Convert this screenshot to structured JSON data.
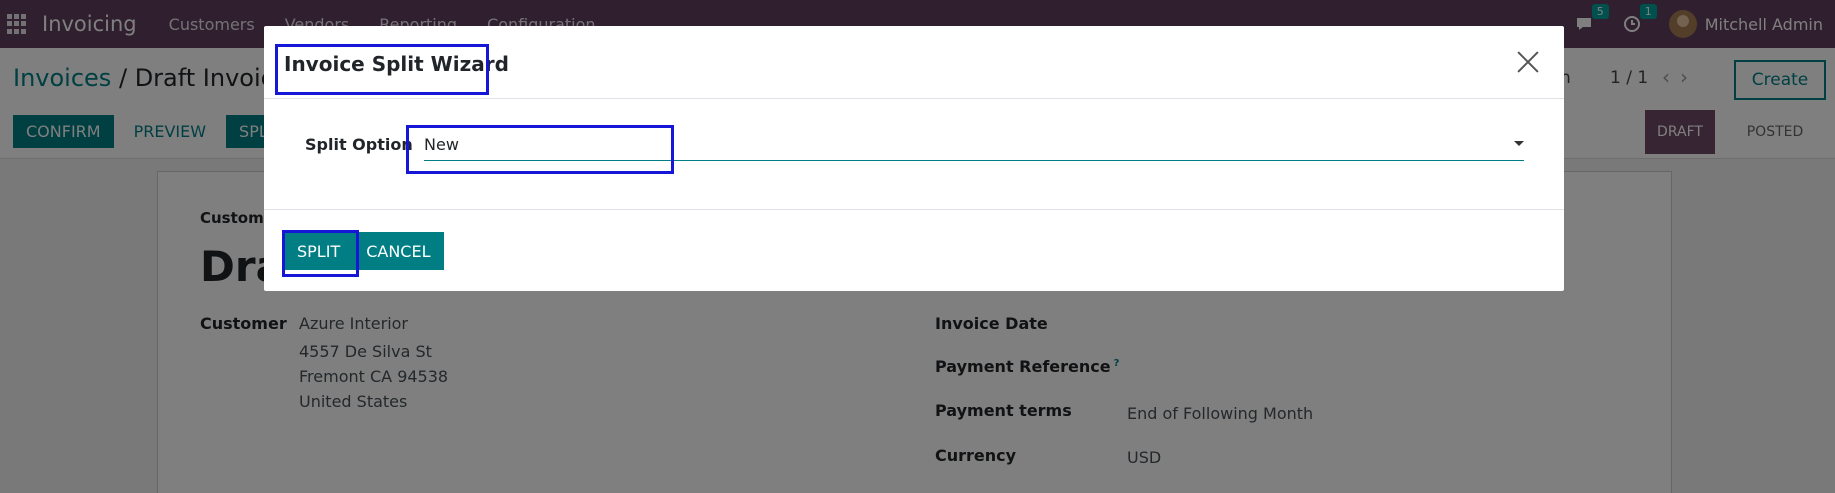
{
  "topnav": {
    "app_title": "Invoicing",
    "menu": [
      "Customers",
      "Vendors",
      "Reporting",
      "Configuration"
    ],
    "messages_badge": "5",
    "activities_badge": "1",
    "user": "Mitchell Admin"
  },
  "control": {
    "breadcrumb_root": "Invoices",
    "breadcrumb_sep": "/",
    "breadcrumb_current": "Draft Invoice",
    "pager": "1 / 1",
    "pager_partial": "n",
    "create": "Create",
    "buttons": [
      "CONFIRM",
      "PREVIEW",
      "SPLIT"
    ],
    "status": [
      "DRAFT",
      "POSTED"
    ]
  },
  "sheet": {
    "customer_top_label": "Customer",
    "title": "Draft",
    "customer_label": "Customer",
    "customer_name": "Azure Interior",
    "address1": "4557 De Silva St",
    "address2": "Fremont CA 94538",
    "country": "United States",
    "invoice_date_label": "Invoice Date",
    "payment_ref_label": "Payment Reference",
    "payment_ref_help": "?",
    "payment_terms_label": "Payment terms",
    "payment_terms": "End of Following Month",
    "currency_label": "Currency",
    "currency": "USD"
  },
  "modal": {
    "title": "Invoice Split Wizard",
    "split_option_label": "Split Option",
    "split_option_value": "New",
    "split_button": "SPLIT",
    "cancel_button": "CANCEL"
  },
  "colors": {
    "nav": "#5f3f5e",
    "primary": "#017e84",
    "highlight": "#1616d6"
  }
}
